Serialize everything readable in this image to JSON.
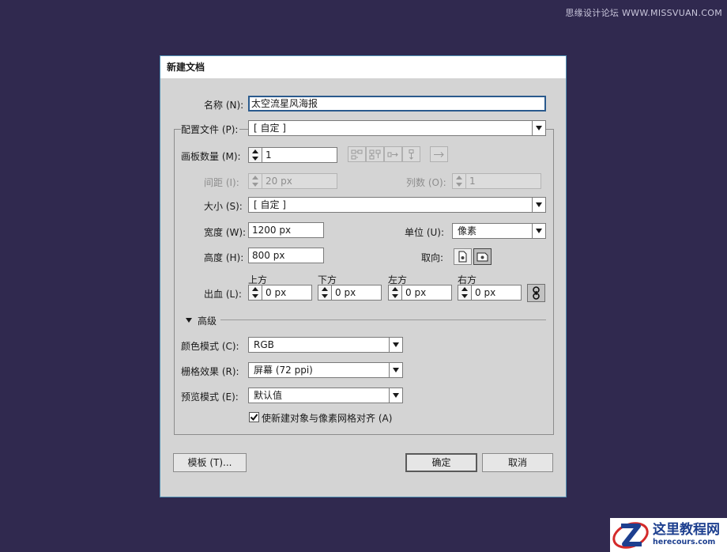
{
  "watermark_top": "思缘设计论坛 WWW.MISSVUAN.COM",
  "watermark_corner": {
    "cn": "这里教程网",
    "en": "herecours.com"
  },
  "dialog": {
    "title": "新建文档",
    "name_label": "名称 (N):",
    "name_value": "太空流星风海报",
    "profile_label": "配置文件 (P):",
    "profile_value": "[ 自定 ]",
    "artboards_label": "画板数量 (M):",
    "artboards_value": "1",
    "spacing_label": "间距 (I):",
    "spacing_value": "20 px",
    "columns_label": "列数 (O):",
    "columns_value": "1",
    "size_label": "大小 (S):",
    "size_value": "[ 自定 ]",
    "width_label": "宽度 (W):",
    "width_value": "1200 px",
    "units_label": "单位 (U):",
    "units_value": "像素",
    "height_label": "高度 (H):",
    "height_value": "800 px",
    "orientation_label": "取向:",
    "bleed_label": "出血 (L):",
    "bleed": {
      "top_label": "上方",
      "top_value": "0 px",
      "bottom_label": "下方",
      "bottom_value": "0 px",
      "left_label": "左方",
      "left_value": "0 px",
      "right_label": "右方",
      "right_value": "0 px"
    },
    "advanced_label": "高级",
    "color_mode_label": "颜色模式 (C):",
    "color_mode_value": "RGB",
    "raster_label": "栅格效果 (R):",
    "raster_value": "屏幕 (72 ppi)",
    "preview_label": "预览模式 (E):",
    "preview_value": "默认值",
    "align_pixel_label": "使新建对象与像素网格对齐 (A)",
    "align_pixel_checked": true,
    "templates_button": "模板 (T)...",
    "ok_button": "确定",
    "cancel_button": "取消"
  },
  "colors": {
    "background": "#30294f",
    "dialog_bg": "#d4d4d4",
    "dialog_border": "#4f8fb3",
    "focus_border": "#2a5a8d",
    "corner_brand": "#1d3f8f",
    "corner_accent": "#d42a2a"
  }
}
